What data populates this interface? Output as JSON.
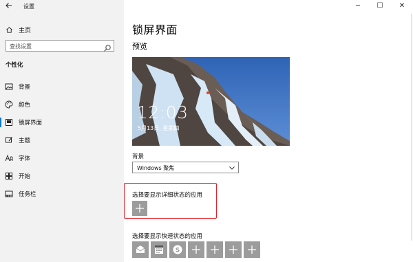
{
  "app_title": "设置",
  "window_controls": {
    "minimize": "─",
    "maximize": "☐",
    "close": "✕"
  },
  "sidebar": {
    "home_label": "主页",
    "search_placeholder": "查找设置",
    "section_title": "个性化",
    "items": [
      {
        "label": "背景",
        "icon": "image-icon"
      },
      {
        "label": "颜色",
        "icon": "palette-icon"
      },
      {
        "label": "锁屏界面",
        "icon": "lock-screen-icon",
        "active": true
      },
      {
        "label": "主题",
        "icon": "brush-icon"
      },
      {
        "label": "字体",
        "icon": "font-icon"
      },
      {
        "label": "开始",
        "icon": "start-icon"
      },
      {
        "label": "任务栏",
        "icon": "taskbar-icon"
      }
    ]
  },
  "main": {
    "title": "锁屏界面",
    "preview_label": "预览",
    "preview": {
      "time": "12:03",
      "date": "5月13日, 星期四"
    },
    "background_label": "背景",
    "background_value": "Windows 聚焦",
    "detailed_status_label": "选择要显示详细状态的应用",
    "quick_status_label": "选择要显示快速状态的应用",
    "quick_status_icons": [
      "mail-icon",
      "calendar-icon",
      "skype-icon",
      "add-icon",
      "add-icon",
      "add-icon",
      "add-icon"
    ]
  },
  "colors": {
    "accent": "#0078d7",
    "highlight_border": "#e0242b",
    "tile": "#9c9c9c"
  }
}
